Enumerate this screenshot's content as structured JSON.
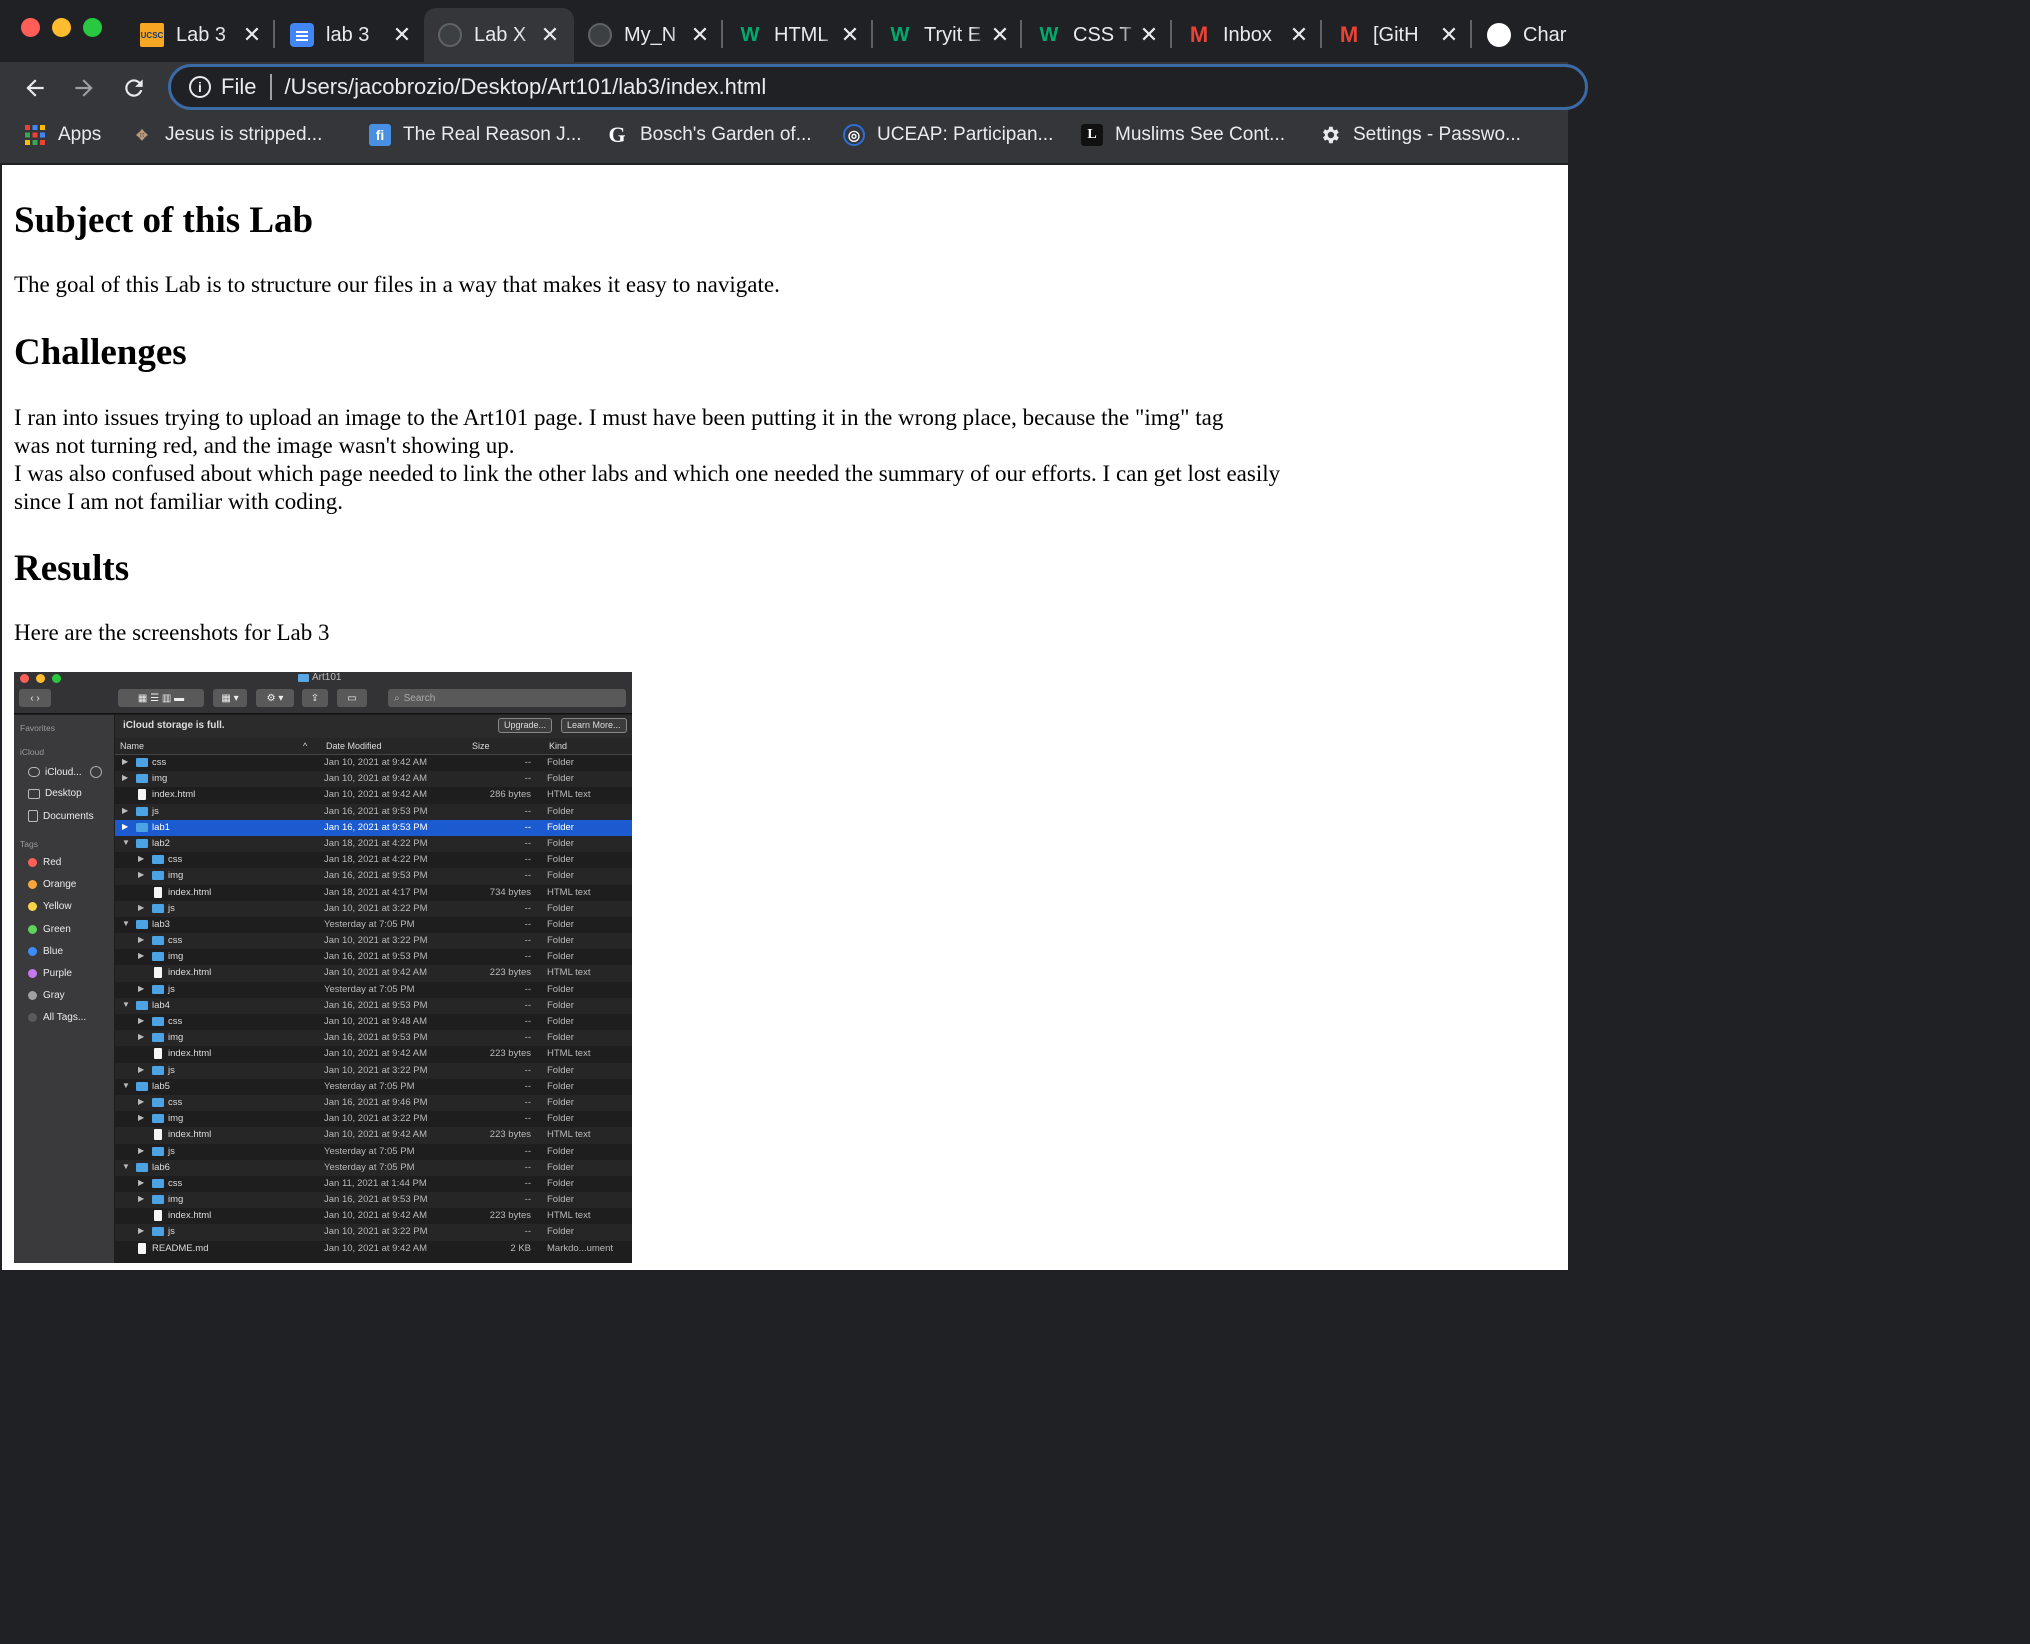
{
  "browser": {
    "tabs": [
      {
        "title": "Lab 3",
        "favicon": "ucsc-icon",
        "favicon_color": "#f5a623",
        "favicon_text": "UCSC"
      },
      {
        "title": "lab 3",
        "favicon": "google-docs-icon",
        "favicon_color": "#4285f4",
        "favicon_text": ""
      },
      {
        "title": "Lab X",
        "favicon": "globe-icon",
        "favicon_color": "#5f6368",
        "favicon_text": "",
        "active": true
      },
      {
        "title": "My_N",
        "favicon": "globe-icon",
        "favicon_color": "#5f6368",
        "favicon_text": ""
      },
      {
        "title": "HTML",
        "favicon": "w3schools-icon",
        "favicon_color": "#04aa6d",
        "favicon_text": "W"
      },
      {
        "title": "Tryit E",
        "favicon": "w3schools-icon",
        "favicon_color": "#04aa6d",
        "favicon_text": "W"
      },
      {
        "title": "CSS T",
        "favicon": "w3schools-icon",
        "favicon_color": "#04aa6d",
        "favicon_text": "W"
      },
      {
        "title": "Inbox",
        "favicon": "gmail-icon",
        "favicon_color": "#ea4335",
        "favicon_text": "M"
      },
      {
        "title": "[GitH",
        "favicon": "gmail-icon",
        "favicon_color": "#ea4335",
        "favicon_text": "M"
      },
      {
        "title": "Char",
        "favicon": "github-icon",
        "favicon_color": "#ffffff",
        "favicon_text": ""
      }
    ],
    "address": {
      "scheme_label": "File",
      "url": "/Users/jacobrozio/Desktop/Art101/lab3/index.html"
    },
    "bookmarks": [
      {
        "label": "Apps",
        "icon": "apps-grid-icon"
      },
      {
        "label": "Jesus is stripped...",
        "icon": "artwork-icon"
      },
      {
        "label": "The Real Reason J...",
        "icon": "fi-icon"
      },
      {
        "label": "Bosch's Garden of...",
        "icon": "g-icon"
      },
      {
        "label": "UCEAP: Participan...",
        "icon": "uceap-icon"
      },
      {
        "label": "Muslims See Cont...",
        "icon": "l-icon"
      },
      {
        "label": "Settings - Passwo...",
        "icon": "gear-icon"
      }
    ]
  },
  "page": {
    "h_subject": "Subject of this Lab",
    "p_subject": "The goal of this Lab is to structure our files in a way that makes it easy to navigate.",
    "h_challenges": "Challenges",
    "p_challenges_1": "I ran into issues trying to upload an image to the Art101 page. I must have been putting it in the wrong place, because the \"img\" tag",
    "p_challenges_2": "was not turning red, and the image wasn't showing up.",
    "p_challenges_3": "I was also confused about which page needed to link the other labs and which one needed the summary of our efforts. I can get lost easily",
    "p_challenges_4": "since I am not familiar with coding.",
    "h_results": "Results",
    "p_results": "Here are the screenshots for Lab 3"
  },
  "finder": {
    "window_title": "Art101",
    "search_placeholder": "Search",
    "banner_message": "iCloud storage is full.",
    "upgrade_label": "Upgrade...",
    "learn_more_label": "Learn More...",
    "columns": {
      "name": "Name",
      "date": "Date Modified",
      "size": "Size",
      "kind": "Kind"
    },
    "sidebar": {
      "favorites_heading": "Favorites",
      "icloud_heading": "iCloud",
      "icloud_items": [
        "iCloud...",
        "Desktop",
        "Documents"
      ],
      "tags_heading": "Tags",
      "tags": [
        {
          "label": "Red",
          "color": "#ff5f57"
        },
        {
          "label": "Orange",
          "color": "#f7a63c"
        },
        {
          "label": "Yellow",
          "color": "#f8d548"
        },
        {
          "label": "Green",
          "color": "#5fd35a"
        },
        {
          "label": "Blue",
          "color": "#3a8dff"
        },
        {
          "label": "Purple",
          "color": "#c479f0"
        },
        {
          "label": "Gray",
          "color": "#a0a0a0"
        },
        {
          "label": "All Tags...",
          "color": "#5a5a5a"
        }
      ]
    },
    "rows": [
      {
        "name": "css",
        "depth": 0,
        "type": "folder",
        "disclosure": "closed",
        "date": "Jan 10, 2021 at 9:42 AM",
        "size": "--",
        "kind": "Folder"
      },
      {
        "name": "img",
        "depth": 0,
        "type": "folder",
        "disclosure": "closed",
        "date": "Jan 10, 2021 at 9:42 AM",
        "size": "--",
        "kind": "Folder"
      },
      {
        "name": "index.html",
        "depth": 0,
        "type": "file",
        "disclosure": "none",
        "date": "Jan 10, 2021 at 9:42 AM",
        "size": "286 bytes",
        "kind": "HTML text"
      },
      {
        "name": "js",
        "depth": 0,
        "type": "folder",
        "disclosure": "closed",
        "date": "Jan 16, 2021 at 9:53 PM",
        "size": "--",
        "kind": "Folder"
      },
      {
        "name": "lab1",
        "depth": 0,
        "type": "folder",
        "disclosure": "closed",
        "date": "Jan 16, 2021 at 9:53 PM",
        "size": "--",
        "kind": "Folder",
        "selected": true
      },
      {
        "name": "lab2",
        "depth": 0,
        "type": "folder",
        "disclosure": "open",
        "date": "Jan 18, 2021 at 4:22 PM",
        "size": "--",
        "kind": "Folder"
      },
      {
        "name": "css",
        "depth": 1,
        "type": "folder",
        "disclosure": "closed",
        "date": "Jan 18, 2021 at 4:22 PM",
        "size": "--",
        "kind": "Folder"
      },
      {
        "name": "img",
        "depth": 1,
        "type": "folder",
        "disclosure": "closed",
        "date": "Jan 16, 2021 at 9:53 PM",
        "size": "--",
        "kind": "Folder"
      },
      {
        "name": "index.html",
        "depth": 1,
        "type": "file",
        "disclosure": "none",
        "date": "Jan 18, 2021 at 4:17 PM",
        "size": "734 bytes",
        "kind": "HTML text"
      },
      {
        "name": "js",
        "depth": 1,
        "type": "folder",
        "disclosure": "closed",
        "date": "Jan 10, 2021 at 3:22 PM",
        "size": "--",
        "kind": "Folder"
      },
      {
        "name": "lab3",
        "depth": 0,
        "type": "folder",
        "disclosure": "open",
        "date": "Yesterday at 7:05 PM",
        "size": "--",
        "kind": "Folder"
      },
      {
        "name": "css",
        "depth": 1,
        "type": "folder",
        "disclosure": "closed",
        "date": "Jan 10, 2021 at 3:22 PM",
        "size": "--",
        "kind": "Folder"
      },
      {
        "name": "img",
        "depth": 1,
        "type": "folder",
        "disclosure": "closed",
        "date": "Jan 16, 2021 at 9:53 PM",
        "size": "--",
        "kind": "Folder"
      },
      {
        "name": "index.html",
        "depth": 1,
        "type": "file",
        "disclosure": "none",
        "date": "Jan 10, 2021 at 9:42 AM",
        "size": "223 bytes",
        "kind": "HTML text"
      },
      {
        "name": "js",
        "depth": 1,
        "type": "folder",
        "disclosure": "closed",
        "date": "Yesterday at 7:05 PM",
        "size": "--",
        "kind": "Folder"
      },
      {
        "name": "lab4",
        "depth": 0,
        "type": "folder",
        "disclosure": "open",
        "date": "Jan 16, 2021 at 9:53 PM",
        "size": "--",
        "kind": "Folder"
      },
      {
        "name": "css",
        "depth": 1,
        "type": "folder",
        "disclosure": "closed",
        "date": "Jan 10, 2021 at 9:48 AM",
        "size": "--",
        "kind": "Folder"
      },
      {
        "name": "img",
        "depth": 1,
        "type": "folder",
        "disclosure": "closed",
        "date": "Jan 16, 2021 at 9:53 PM",
        "size": "--",
        "kind": "Folder"
      },
      {
        "name": "index.html",
        "depth": 1,
        "type": "file",
        "disclosure": "none",
        "date": "Jan 10, 2021 at 9:42 AM",
        "size": "223 bytes",
        "kind": "HTML text"
      },
      {
        "name": "js",
        "depth": 1,
        "type": "folder",
        "disclosure": "closed",
        "date": "Jan 10, 2021 at 3:22 PM",
        "size": "--",
        "kind": "Folder"
      },
      {
        "name": "lab5",
        "depth": 0,
        "type": "folder",
        "disclosure": "open",
        "date": "Yesterday at 7:05 PM",
        "size": "--",
        "kind": "Folder"
      },
      {
        "name": "css",
        "depth": 1,
        "type": "folder",
        "disclosure": "closed",
        "date": "Jan 16, 2021 at 9:46 PM",
        "size": "--",
        "kind": "Folder"
      },
      {
        "name": "img",
        "depth": 1,
        "type": "folder",
        "disclosure": "closed",
        "date": "Jan 10, 2021 at 3:22 PM",
        "size": "--",
        "kind": "Folder"
      },
      {
        "name": "index.html",
        "depth": 1,
        "type": "file",
        "disclosure": "none",
        "date": "Jan 10, 2021 at 9:42 AM",
        "size": "223 bytes",
        "kind": "HTML text"
      },
      {
        "name": "js",
        "depth": 1,
        "type": "folder",
        "disclosure": "closed",
        "date": "Yesterday at 7:05 PM",
        "size": "--",
        "kind": "Folder"
      },
      {
        "name": "lab6",
        "depth": 0,
        "type": "folder",
        "disclosure": "open",
        "date": "Yesterday at 7:05 PM",
        "size": "--",
        "kind": "Folder"
      },
      {
        "name": "css",
        "depth": 1,
        "type": "folder",
        "disclosure": "closed",
        "date": "Jan 11, 2021 at 1:44 PM",
        "size": "--",
        "kind": "Folder"
      },
      {
        "name": "img",
        "depth": 1,
        "type": "folder",
        "disclosure": "closed",
        "date": "Jan 16, 2021 at 9:53 PM",
        "size": "--",
        "kind": "Folder"
      },
      {
        "name": "index.html",
        "depth": 1,
        "type": "file",
        "disclosure": "none",
        "date": "Jan 10, 2021 at 9:42 AM",
        "size": "223 bytes",
        "kind": "HTML text"
      },
      {
        "name": "js",
        "depth": 1,
        "type": "folder",
        "disclosure": "closed",
        "date": "Jan 10, 2021 at 3:22 PM",
        "size": "--",
        "kind": "Folder"
      },
      {
        "name": "README.md",
        "depth": 0,
        "type": "file",
        "disclosure": "none",
        "date": "Jan 10, 2021 at 9:42 AM",
        "size": "2 KB",
        "kind": "Markdo...ument"
      }
    ]
  }
}
